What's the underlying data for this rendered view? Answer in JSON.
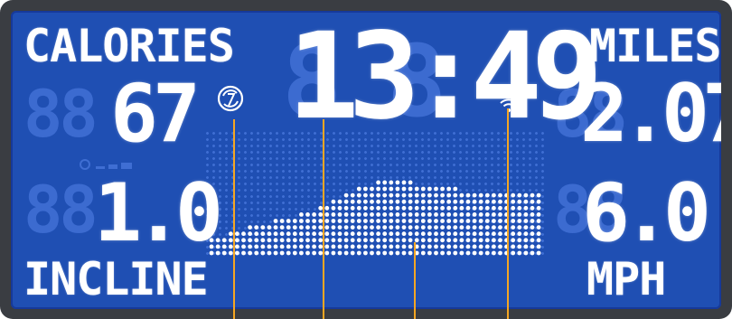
{
  "display": {
    "calories_label": "CALORIES",
    "calories_value": "67",
    "time_value": "13:49",
    "miles_label": "MILES",
    "miles_value": "2.07",
    "incline_value": "1.0",
    "incline_label": "INCLINE",
    "speed_value": "6.0",
    "speed_label": "MPH"
  },
  "icons": {
    "sync": "sync-icon",
    "wireless": "wireless-icon",
    "fan": "fan-icon"
  },
  "colors": {
    "screen": "#1f4fb3",
    "lit": "#ffffff",
    "unlit": "#3f6ed3",
    "leader": "#f5a623"
  },
  "workout_profile": {
    "column_heights": [
      3,
      3,
      3,
      4,
      4,
      4,
      5,
      5,
      5,
      5,
      6,
      6,
      6,
      6,
      7,
      7,
      7,
      8,
      8,
      9,
      9,
      10,
      10,
      11,
      11,
      11,
      12,
      12,
      12,
      12,
      12,
      12,
      11,
      11,
      11,
      11,
      11,
      11,
      11,
      10,
      10,
      10,
      10,
      10,
      10,
      10,
      10,
      10,
      10,
      10,
      10,
      10
    ],
    "max_height": 13
  }
}
